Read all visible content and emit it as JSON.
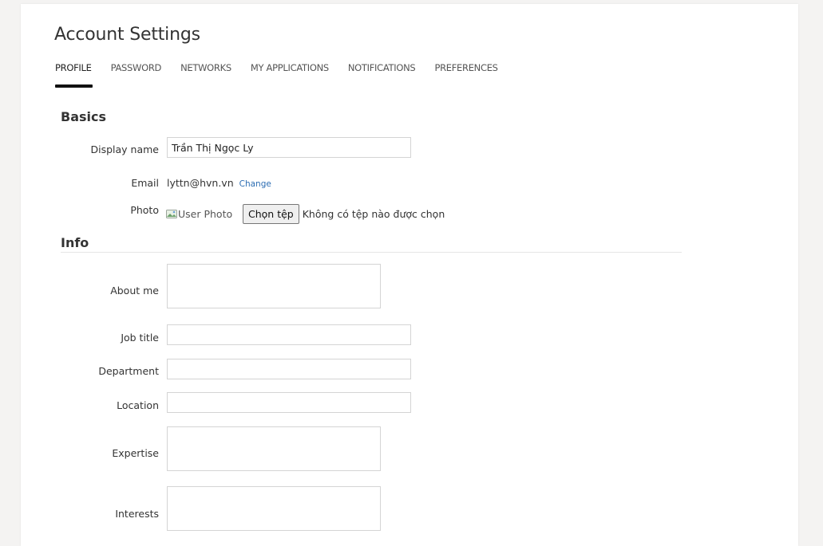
{
  "page": {
    "title": "Account Settings"
  },
  "tabs": [
    {
      "label": "PROFILE",
      "active": true
    },
    {
      "label": "PASSWORD",
      "active": false
    },
    {
      "label": "NETWORKS",
      "active": false
    },
    {
      "label": "MY APPLICATIONS",
      "active": false
    },
    {
      "label": "NOTIFICATIONS",
      "active": false
    },
    {
      "label": "PREFERENCES",
      "active": false
    }
  ],
  "basics": {
    "heading": "Basics",
    "display_name": {
      "label": "Display name",
      "value": "Trần Thị Ngọc Ly"
    },
    "email": {
      "label": "Email",
      "value": "lyttn@hvn.vn",
      "change_link": "Change"
    },
    "photo": {
      "label": "Photo",
      "alt": "User Photo",
      "icon": "broken-image-icon",
      "choose_button": "Chọn tệp",
      "no_file": "Không có tệp nào được chọn"
    }
  },
  "info": {
    "heading": "Info",
    "about_me": {
      "label": "About me",
      "value": ""
    },
    "job_title": {
      "label": "Job title",
      "value": ""
    },
    "department": {
      "label": "Department",
      "value": ""
    },
    "location": {
      "label": "Location",
      "value": ""
    },
    "expertise": {
      "label": "Expertise",
      "value": ""
    },
    "interests": {
      "label": "Interests",
      "value": ""
    }
  },
  "colors": {
    "link": "#2c6db3",
    "active_tab_underline": "#111111",
    "background": "#f4f3f2"
  }
}
